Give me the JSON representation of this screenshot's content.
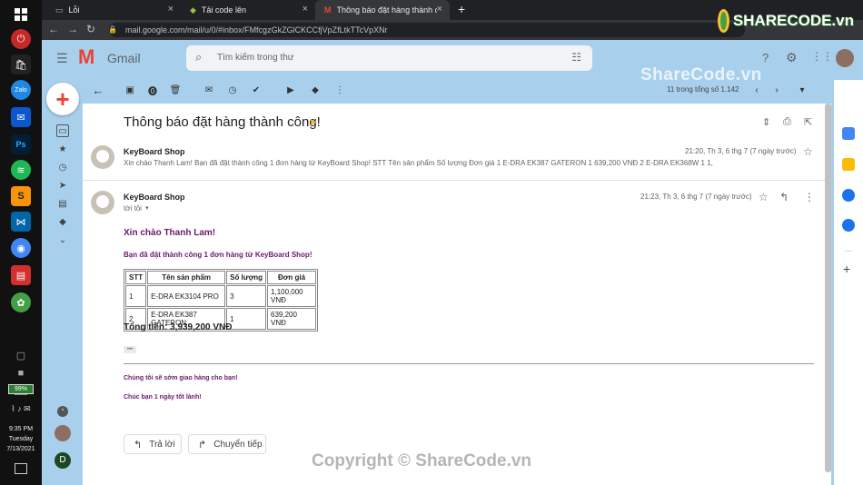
{
  "browser": {
    "tabs": [
      {
        "title": "Lỗi",
        "icon": "doc-icon"
      },
      {
        "title": "Tải code lên",
        "icon": "sharecode-icon"
      },
      {
        "title": "Thông báo đặt hàng thành công",
        "icon": "gmail-icon"
      }
    ],
    "url": "mail.google.com/mail/u/0/#inbox/FMfcgzGkZGlCKCCfjVpZfLtkTTcVpXNr"
  },
  "gmail": {
    "brand": "Gmail",
    "search_placeholder": "Tìm kiếm trong thư",
    "pagination": "11 trong tổng số 1.142",
    "subject": "Thông báo đặt hàng thành công!",
    "messages": [
      {
        "sender": "KeyBoard Shop",
        "time": "21:20, Th 3, 6 thg 7 (7 ngày trước)",
        "snippet": "Xin chào Thanh Lam! Bạn đã đặt thành công 1 đơn hàng từ KeyBoard Shop! STT Tên sản phẩm Số lượng Đơn giá 1 E-DRA EK387 GATERON 1 639,200 VNĐ 2 E-DRA EK368W 1 1,"
      },
      {
        "sender": "KeyBoard Shop",
        "time": "21:23, Th 3, 6 thg 7 (7 ngày trước)",
        "to": "tới tôi"
      }
    ],
    "body": {
      "greeting": "Xin chào Thanh Lam!",
      "intro": "Bạn đã đặt thành công 1 đơn hàng từ KeyBoard Shop!",
      "table_headers": [
        "STT",
        "Tên sản phẩm",
        "Số lượng",
        "Đơn giá"
      ],
      "rows": [
        [
          "1",
          "E-DRA EK3104 PRO",
          "3",
          "1,100,000 VNĐ"
        ],
        [
          "2",
          "E-DRA EK387 GATERON",
          "1",
          "639,200 VNĐ"
        ]
      ],
      "total": "Tổng tiền: 3,939,200 VNĐ",
      "ellipsis": "•••",
      "line1": "Chúng tôi sẽ sớm giao hàng cho bạn!",
      "line2": "Chúc bạn 1 ngày tốt lành!"
    },
    "reply_label": "Trả lời",
    "forward_label": "Chuyển tiếp"
  },
  "taskbar": {
    "battery": "99%",
    "time": "9:35 PM",
    "day": "Tuesday",
    "date": "7/13/2021",
    "account_initial": "D"
  },
  "watermark": {
    "logo_text": "SHARECODE.vn",
    "mid_text": "ShareCode.vn",
    "copyright": "Copyright © ShareCode.vn"
  },
  "colors": {
    "gmail_bg": "#a8d0ec",
    "accent_red": "#ea4335",
    "purple_text": "#6a1b6a"
  }
}
